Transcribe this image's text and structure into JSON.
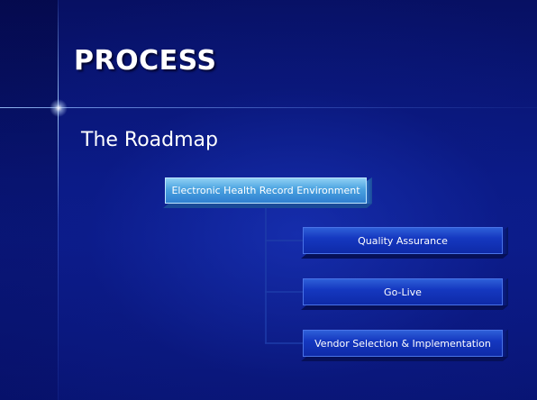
{
  "slide": {
    "title": "PROCESS",
    "subtitle": "The Roadmap"
  },
  "diagram": {
    "root": "Electronic Health Record Environment",
    "children": [
      "Quality Assurance",
      "Go-Live",
      "Vendor Selection & Implementation"
    ]
  },
  "colors": {
    "background": "#0a1a86",
    "root_box": "#4aa2e0",
    "child_box": "#1538c0",
    "text": "#ffffff"
  }
}
